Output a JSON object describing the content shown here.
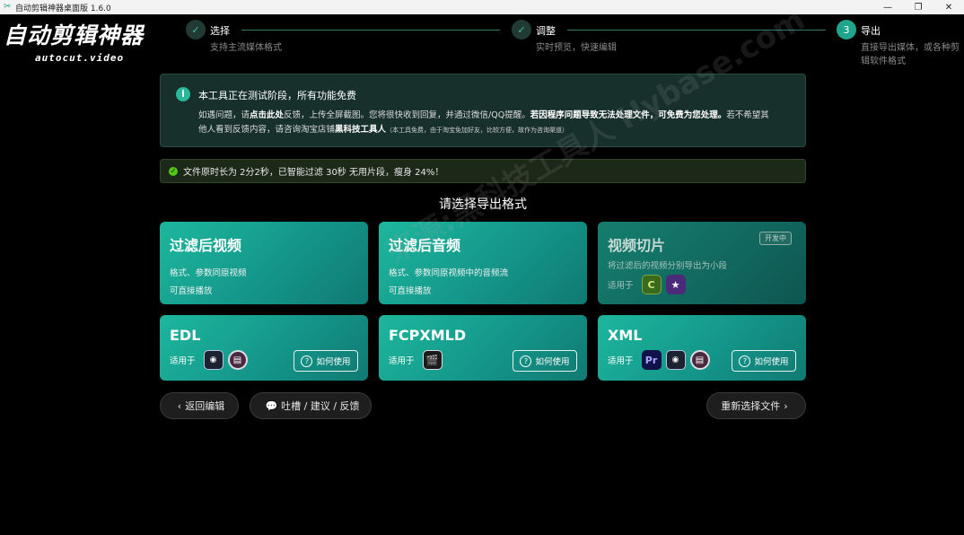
{
  "window": {
    "title": "自动剪辑神器桌面版 1.6.0",
    "buttons": [
      "—",
      "❐",
      "✕"
    ]
  },
  "logo": {
    "main": "自动剪辑神器",
    "sub": "autocut.video"
  },
  "steps": [
    {
      "index": "✓",
      "name": "选择",
      "desc": "支持主流媒体格式",
      "state": "done"
    },
    {
      "index": "✓",
      "name": "调整",
      "desc": "实时预览，快速编辑",
      "state": "done"
    },
    {
      "index": "3",
      "name": "导出",
      "desc_line1": "直接导出媒体，或各种剪",
      "desc_line2": "辑软件格式",
      "state": "active"
    }
  ],
  "notice": {
    "icon": "info-icon",
    "headline": "本工具正在测试阶段，所有功能免费",
    "p1_a": "如遇问题，请",
    "p1_link": "点击此处",
    "p1_b": "反馈，上传全屏截图。您将很快收到回复，并通过微信/QQ提醒。",
    "p1_bold": "若因程序问题导致无法处理文件，可免费为您处理。",
    "p1_c": "若不希望其",
    "p2_a": "他人看到反馈内容，请咨询淘宝店铺",
    "p2_bold": "黑科技工具人",
    "p2_small": "（本工具免费，由于淘宝免加好友，比较方便，故作为咨询渠道）"
  },
  "status": {
    "icon": "check-circle-icon",
    "text": "文件原时长为 2分2秒，已智能过滤 30秒 无用片段，瘦身 24%！"
  },
  "section_title": "请选择导出格式",
  "cards": {
    "video": {
      "title": "过滤后视频",
      "line1": "格式、参数同原视频",
      "line2": "可直接播放"
    },
    "audio": {
      "title": "过滤后音频",
      "line1": "格式、参数同原视频中的音频流",
      "line2": "可直接播放"
    },
    "clips": {
      "title": "视频切片",
      "badge": "开发中",
      "line1": "将过滤后的视频分别导出为小段",
      "use_label": "适用于"
    },
    "edl": {
      "title": "EDL",
      "use_label": "适用于",
      "howto": "如何使用"
    },
    "fcpxml": {
      "title": "FCPXMLD",
      "use_label": "适用于",
      "howto": "如何使用"
    },
    "xml": {
      "title": "XML",
      "use_label": "适用于",
      "howto": "如何使用"
    }
  },
  "app_glyphs": {
    "camtasia": "C",
    "imovie": "★",
    "resolve": "◉",
    "film": "▤",
    "fcp": "🎬",
    "premiere": "Pr"
  },
  "bottom": {
    "back": "返回编辑",
    "feedback": "吐槽 / 建议 / 反馈",
    "reselect": "重新选择文件"
  },
  "watermark": "来源:黑科技工具人 Hybase.com",
  "colors": {
    "accent": "#1fa48d",
    "card_start": "#1db79d",
    "card_end": "#107a72",
    "success": "#52c41a"
  }
}
